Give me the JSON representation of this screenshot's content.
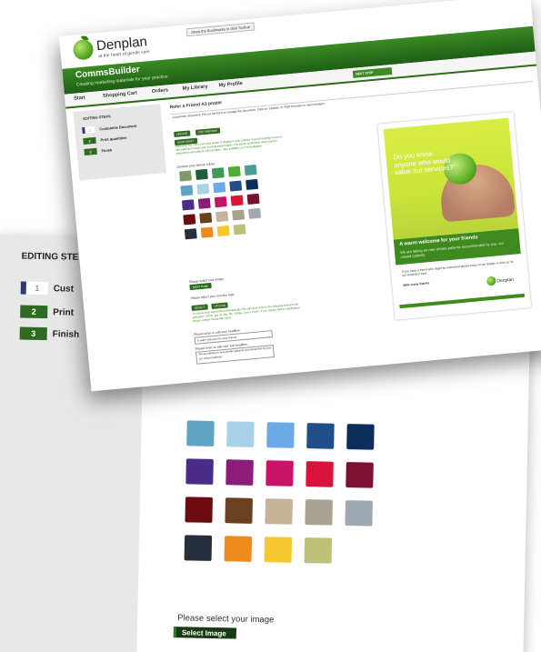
{
  "back": {
    "sidebar_title": "EDITING STE",
    "steps": [
      {
        "num": "1",
        "label": "Cust"
      },
      {
        "num": "2",
        "label": "Print"
      },
      {
        "num": "3",
        "label": "Finish"
      }
    ],
    "swatches": [
      "#5fa4c7",
      "#a8d2ea",
      "#6aaae8",
      "#1f4f8a",
      "#0d2e5c",
      "#4a2d88",
      "#8c1c7a",
      "#c81268",
      "#d8143a",
      "#7a1130",
      "#6d0c0f",
      "#6b4021",
      "#c7b29a",
      "#a9a392",
      "#a0a8b2",
      "#27303a",
      "#ef8b1e",
      "#f5c92d",
      "#bcc27a"
    ],
    "select_image_label": "Please select your image",
    "select_image_button": "Select Image"
  },
  "front": {
    "logo_text": "Denplan",
    "logo_tagline": "at the heart of gentle care",
    "help_link": "Show the Bookmarks in click Toolbar",
    "app_title": "CommsBuilder",
    "app_subtitle": "Creating marketing materials for your practice",
    "nav": [
      "Start",
      "Shopping Cart",
      "Orders",
      "My Library",
      "My Profile"
    ],
    "next_step": "NEXT STEP",
    "editing_steps_title": "EDITING STEPS",
    "steps": [
      {
        "num": "1",
        "label": "Customise Document"
      },
      {
        "num": "2",
        "label": "Print quantities"
      },
      {
        "num": "3",
        "label": "Finish"
      }
    ],
    "panel_title": "Refer a Friend A3 poster",
    "instructions": "Customise document. Fill out the form to change the document. Click on 'Update' or 'PDF Preview' to view changes.",
    "update_btn": "UPDATE",
    "pdf_btn": "PDF PREVIEW",
    "save_btn": "SAVE DRAFT",
    "tip": "Marketing Tip: This is an ideal poster to display in your practice if you're looking to recruit new patients through your existing patient base. The poster works best when used in conjunction with patient referral cards - also available on CommsBuilder.",
    "choose_colours": "Choose your theme colour",
    "swatches": [
      "#7d9b6a",
      "#1f5e3b",
      "#3f9a5a",
      "#4caf32",
      "#4a9e9a",
      "#5fa4c7",
      "#a8d2ea",
      "#6aaae8",
      "#1f4f8a",
      "#0d2e5c",
      "#4a2d88",
      "#8c1c7a",
      "#c81268",
      "#d8143a",
      "#7a1130",
      "#6d0c0f",
      "#6b4021",
      "#c7b29a",
      "#a9a392",
      "#a0a8b2",
      "#27303a",
      "#ef8b1e",
      "#f5c92d",
      "#bcc27a"
    ],
    "select_image_label": "Please select your image",
    "select_image_button": "Select Image",
    "practice_logo_label": "Please select your practice logo",
    "select_btn": "SELECT",
    "upload_btn": "UPLOAD",
    "logo_note": "To ensure your logo prints professionally, this will need to be in the following format to be uploaded. CMYK, jpg, tif, eps, file, 300dpi, 2cm x 2.5cm. If you require further clarification, please contact Visual Mar Ideas.",
    "headline_label": "Please enter or edit your headline:",
    "headline_value": "A warm welcome for your friends",
    "subheadline_label": "Please enter or edit your sub-headline:",
    "subheadline_value": "We are taking on new private patients recommended by you, our valued patients"
  },
  "poster": {
    "question": "Do you know anyone who would value our services?",
    "band_title": "A warm welcome for your friends",
    "band_text": "We are taking on new private patients recommended by you, our valued patients",
    "body": "If you have a friend who might be interested please pass on our details or pick up for our treatment card",
    "thanks": "With many thanks",
    "logo": "Denplan"
  }
}
